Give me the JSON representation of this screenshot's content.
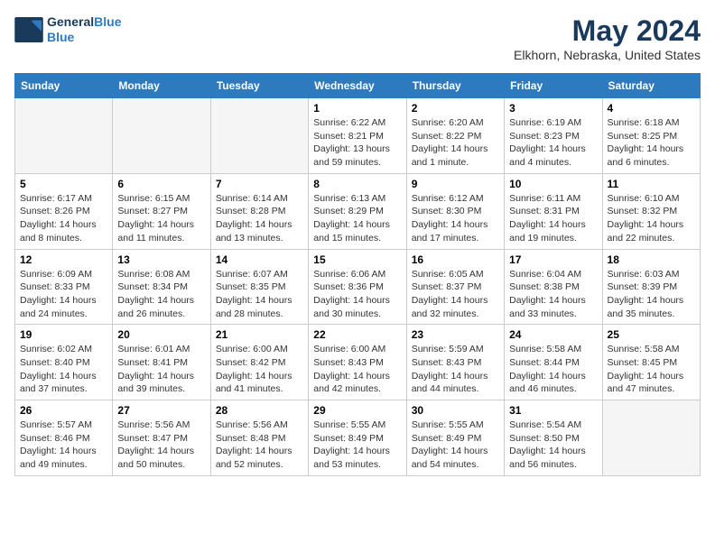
{
  "header": {
    "logo_line1": "General",
    "logo_line2": "Blue",
    "month_title": "May 2024",
    "subtitle": "Elkhorn, Nebraska, United States"
  },
  "days_of_week": [
    "Sunday",
    "Monday",
    "Tuesday",
    "Wednesday",
    "Thursday",
    "Friday",
    "Saturday"
  ],
  "weeks": [
    [
      {
        "day": "",
        "info": ""
      },
      {
        "day": "",
        "info": ""
      },
      {
        "day": "",
        "info": ""
      },
      {
        "day": "1",
        "info": "Sunrise: 6:22 AM\nSunset: 8:21 PM\nDaylight: 13 hours and 59 minutes."
      },
      {
        "day": "2",
        "info": "Sunrise: 6:20 AM\nSunset: 8:22 PM\nDaylight: 14 hours and 1 minute."
      },
      {
        "day": "3",
        "info": "Sunrise: 6:19 AM\nSunset: 8:23 PM\nDaylight: 14 hours and 4 minutes."
      },
      {
        "day": "4",
        "info": "Sunrise: 6:18 AM\nSunset: 8:25 PM\nDaylight: 14 hours and 6 minutes."
      }
    ],
    [
      {
        "day": "5",
        "info": "Sunrise: 6:17 AM\nSunset: 8:26 PM\nDaylight: 14 hours and 8 minutes."
      },
      {
        "day": "6",
        "info": "Sunrise: 6:15 AM\nSunset: 8:27 PM\nDaylight: 14 hours and 11 minutes."
      },
      {
        "day": "7",
        "info": "Sunrise: 6:14 AM\nSunset: 8:28 PM\nDaylight: 14 hours and 13 minutes."
      },
      {
        "day": "8",
        "info": "Sunrise: 6:13 AM\nSunset: 8:29 PM\nDaylight: 14 hours and 15 minutes."
      },
      {
        "day": "9",
        "info": "Sunrise: 6:12 AM\nSunset: 8:30 PM\nDaylight: 14 hours and 17 minutes."
      },
      {
        "day": "10",
        "info": "Sunrise: 6:11 AM\nSunset: 8:31 PM\nDaylight: 14 hours and 19 minutes."
      },
      {
        "day": "11",
        "info": "Sunrise: 6:10 AM\nSunset: 8:32 PM\nDaylight: 14 hours and 22 minutes."
      }
    ],
    [
      {
        "day": "12",
        "info": "Sunrise: 6:09 AM\nSunset: 8:33 PM\nDaylight: 14 hours and 24 minutes."
      },
      {
        "day": "13",
        "info": "Sunrise: 6:08 AM\nSunset: 8:34 PM\nDaylight: 14 hours and 26 minutes."
      },
      {
        "day": "14",
        "info": "Sunrise: 6:07 AM\nSunset: 8:35 PM\nDaylight: 14 hours and 28 minutes."
      },
      {
        "day": "15",
        "info": "Sunrise: 6:06 AM\nSunset: 8:36 PM\nDaylight: 14 hours and 30 minutes."
      },
      {
        "day": "16",
        "info": "Sunrise: 6:05 AM\nSunset: 8:37 PM\nDaylight: 14 hours and 32 minutes."
      },
      {
        "day": "17",
        "info": "Sunrise: 6:04 AM\nSunset: 8:38 PM\nDaylight: 14 hours and 33 minutes."
      },
      {
        "day": "18",
        "info": "Sunrise: 6:03 AM\nSunset: 8:39 PM\nDaylight: 14 hours and 35 minutes."
      }
    ],
    [
      {
        "day": "19",
        "info": "Sunrise: 6:02 AM\nSunset: 8:40 PM\nDaylight: 14 hours and 37 minutes."
      },
      {
        "day": "20",
        "info": "Sunrise: 6:01 AM\nSunset: 8:41 PM\nDaylight: 14 hours and 39 minutes."
      },
      {
        "day": "21",
        "info": "Sunrise: 6:00 AM\nSunset: 8:42 PM\nDaylight: 14 hours and 41 minutes."
      },
      {
        "day": "22",
        "info": "Sunrise: 6:00 AM\nSunset: 8:43 PM\nDaylight: 14 hours and 42 minutes."
      },
      {
        "day": "23",
        "info": "Sunrise: 5:59 AM\nSunset: 8:43 PM\nDaylight: 14 hours and 44 minutes."
      },
      {
        "day": "24",
        "info": "Sunrise: 5:58 AM\nSunset: 8:44 PM\nDaylight: 14 hours and 46 minutes."
      },
      {
        "day": "25",
        "info": "Sunrise: 5:58 AM\nSunset: 8:45 PM\nDaylight: 14 hours and 47 minutes."
      }
    ],
    [
      {
        "day": "26",
        "info": "Sunrise: 5:57 AM\nSunset: 8:46 PM\nDaylight: 14 hours and 49 minutes."
      },
      {
        "day": "27",
        "info": "Sunrise: 5:56 AM\nSunset: 8:47 PM\nDaylight: 14 hours and 50 minutes."
      },
      {
        "day": "28",
        "info": "Sunrise: 5:56 AM\nSunset: 8:48 PM\nDaylight: 14 hours and 52 minutes."
      },
      {
        "day": "29",
        "info": "Sunrise: 5:55 AM\nSunset: 8:49 PM\nDaylight: 14 hours and 53 minutes."
      },
      {
        "day": "30",
        "info": "Sunrise: 5:55 AM\nSunset: 8:49 PM\nDaylight: 14 hours and 54 minutes."
      },
      {
        "day": "31",
        "info": "Sunrise: 5:54 AM\nSunset: 8:50 PM\nDaylight: 14 hours and 56 minutes."
      },
      {
        "day": "",
        "info": ""
      }
    ]
  ]
}
